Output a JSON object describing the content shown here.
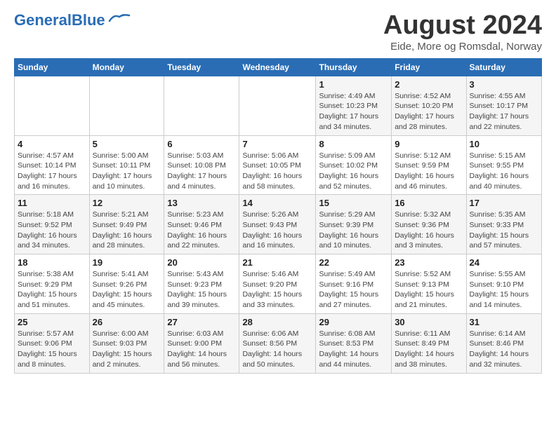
{
  "header": {
    "logo_line1": "General",
    "logo_line2": "Blue",
    "title": "August 2024",
    "subtitle": "Eide, More og Romsdal, Norway"
  },
  "weekdays": [
    "Sunday",
    "Monday",
    "Tuesday",
    "Wednesday",
    "Thursday",
    "Friday",
    "Saturday"
  ],
  "weeks": [
    [
      {
        "day": "",
        "info": ""
      },
      {
        "day": "",
        "info": ""
      },
      {
        "day": "",
        "info": ""
      },
      {
        "day": "",
        "info": ""
      },
      {
        "day": "1",
        "info": "Sunrise: 4:49 AM\nSunset: 10:23 PM\nDaylight: 17 hours\nand 34 minutes."
      },
      {
        "day": "2",
        "info": "Sunrise: 4:52 AM\nSunset: 10:20 PM\nDaylight: 17 hours\nand 28 minutes."
      },
      {
        "day": "3",
        "info": "Sunrise: 4:55 AM\nSunset: 10:17 PM\nDaylight: 17 hours\nand 22 minutes."
      }
    ],
    [
      {
        "day": "4",
        "info": "Sunrise: 4:57 AM\nSunset: 10:14 PM\nDaylight: 17 hours\nand 16 minutes."
      },
      {
        "day": "5",
        "info": "Sunrise: 5:00 AM\nSunset: 10:11 PM\nDaylight: 17 hours\nand 10 minutes."
      },
      {
        "day": "6",
        "info": "Sunrise: 5:03 AM\nSunset: 10:08 PM\nDaylight: 17 hours\nand 4 minutes."
      },
      {
        "day": "7",
        "info": "Sunrise: 5:06 AM\nSunset: 10:05 PM\nDaylight: 16 hours\nand 58 minutes."
      },
      {
        "day": "8",
        "info": "Sunrise: 5:09 AM\nSunset: 10:02 PM\nDaylight: 16 hours\nand 52 minutes."
      },
      {
        "day": "9",
        "info": "Sunrise: 5:12 AM\nSunset: 9:59 PM\nDaylight: 16 hours\nand 46 minutes."
      },
      {
        "day": "10",
        "info": "Sunrise: 5:15 AM\nSunset: 9:55 PM\nDaylight: 16 hours\nand 40 minutes."
      }
    ],
    [
      {
        "day": "11",
        "info": "Sunrise: 5:18 AM\nSunset: 9:52 PM\nDaylight: 16 hours\nand 34 minutes."
      },
      {
        "day": "12",
        "info": "Sunrise: 5:21 AM\nSunset: 9:49 PM\nDaylight: 16 hours\nand 28 minutes."
      },
      {
        "day": "13",
        "info": "Sunrise: 5:23 AM\nSunset: 9:46 PM\nDaylight: 16 hours\nand 22 minutes."
      },
      {
        "day": "14",
        "info": "Sunrise: 5:26 AM\nSunset: 9:43 PM\nDaylight: 16 hours\nand 16 minutes."
      },
      {
        "day": "15",
        "info": "Sunrise: 5:29 AM\nSunset: 9:39 PM\nDaylight: 16 hours\nand 10 minutes."
      },
      {
        "day": "16",
        "info": "Sunrise: 5:32 AM\nSunset: 9:36 PM\nDaylight: 16 hours\nand 3 minutes."
      },
      {
        "day": "17",
        "info": "Sunrise: 5:35 AM\nSunset: 9:33 PM\nDaylight: 15 hours\nand 57 minutes."
      }
    ],
    [
      {
        "day": "18",
        "info": "Sunrise: 5:38 AM\nSunset: 9:29 PM\nDaylight: 15 hours\nand 51 minutes."
      },
      {
        "day": "19",
        "info": "Sunrise: 5:41 AM\nSunset: 9:26 PM\nDaylight: 15 hours\nand 45 minutes."
      },
      {
        "day": "20",
        "info": "Sunrise: 5:43 AM\nSunset: 9:23 PM\nDaylight: 15 hours\nand 39 minutes."
      },
      {
        "day": "21",
        "info": "Sunrise: 5:46 AM\nSunset: 9:20 PM\nDaylight: 15 hours\nand 33 minutes."
      },
      {
        "day": "22",
        "info": "Sunrise: 5:49 AM\nSunset: 9:16 PM\nDaylight: 15 hours\nand 27 minutes."
      },
      {
        "day": "23",
        "info": "Sunrise: 5:52 AM\nSunset: 9:13 PM\nDaylight: 15 hours\nand 21 minutes."
      },
      {
        "day": "24",
        "info": "Sunrise: 5:55 AM\nSunset: 9:10 PM\nDaylight: 15 hours\nand 14 minutes."
      }
    ],
    [
      {
        "day": "25",
        "info": "Sunrise: 5:57 AM\nSunset: 9:06 PM\nDaylight: 15 hours\nand 8 minutes."
      },
      {
        "day": "26",
        "info": "Sunrise: 6:00 AM\nSunset: 9:03 PM\nDaylight: 15 hours\nand 2 minutes."
      },
      {
        "day": "27",
        "info": "Sunrise: 6:03 AM\nSunset: 9:00 PM\nDaylight: 14 hours\nand 56 minutes."
      },
      {
        "day": "28",
        "info": "Sunrise: 6:06 AM\nSunset: 8:56 PM\nDaylight: 14 hours\nand 50 minutes."
      },
      {
        "day": "29",
        "info": "Sunrise: 6:08 AM\nSunset: 8:53 PM\nDaylight: 14 hours\nand 44 minutes."
      },
      {
        "day": "30",
        "info": "Sunrise: 6:11 AM\nSunset: 8:49 PM\nDaylight: 14 hours\nand 38 minutes."
      },
      {
        "day": "31",
        "info": "Sunrise: 6:14 AM\nSunset: 8:46 PM\nDaylight: 14 hours\nand 32 minutes."
      }
    ]
  ]
}
